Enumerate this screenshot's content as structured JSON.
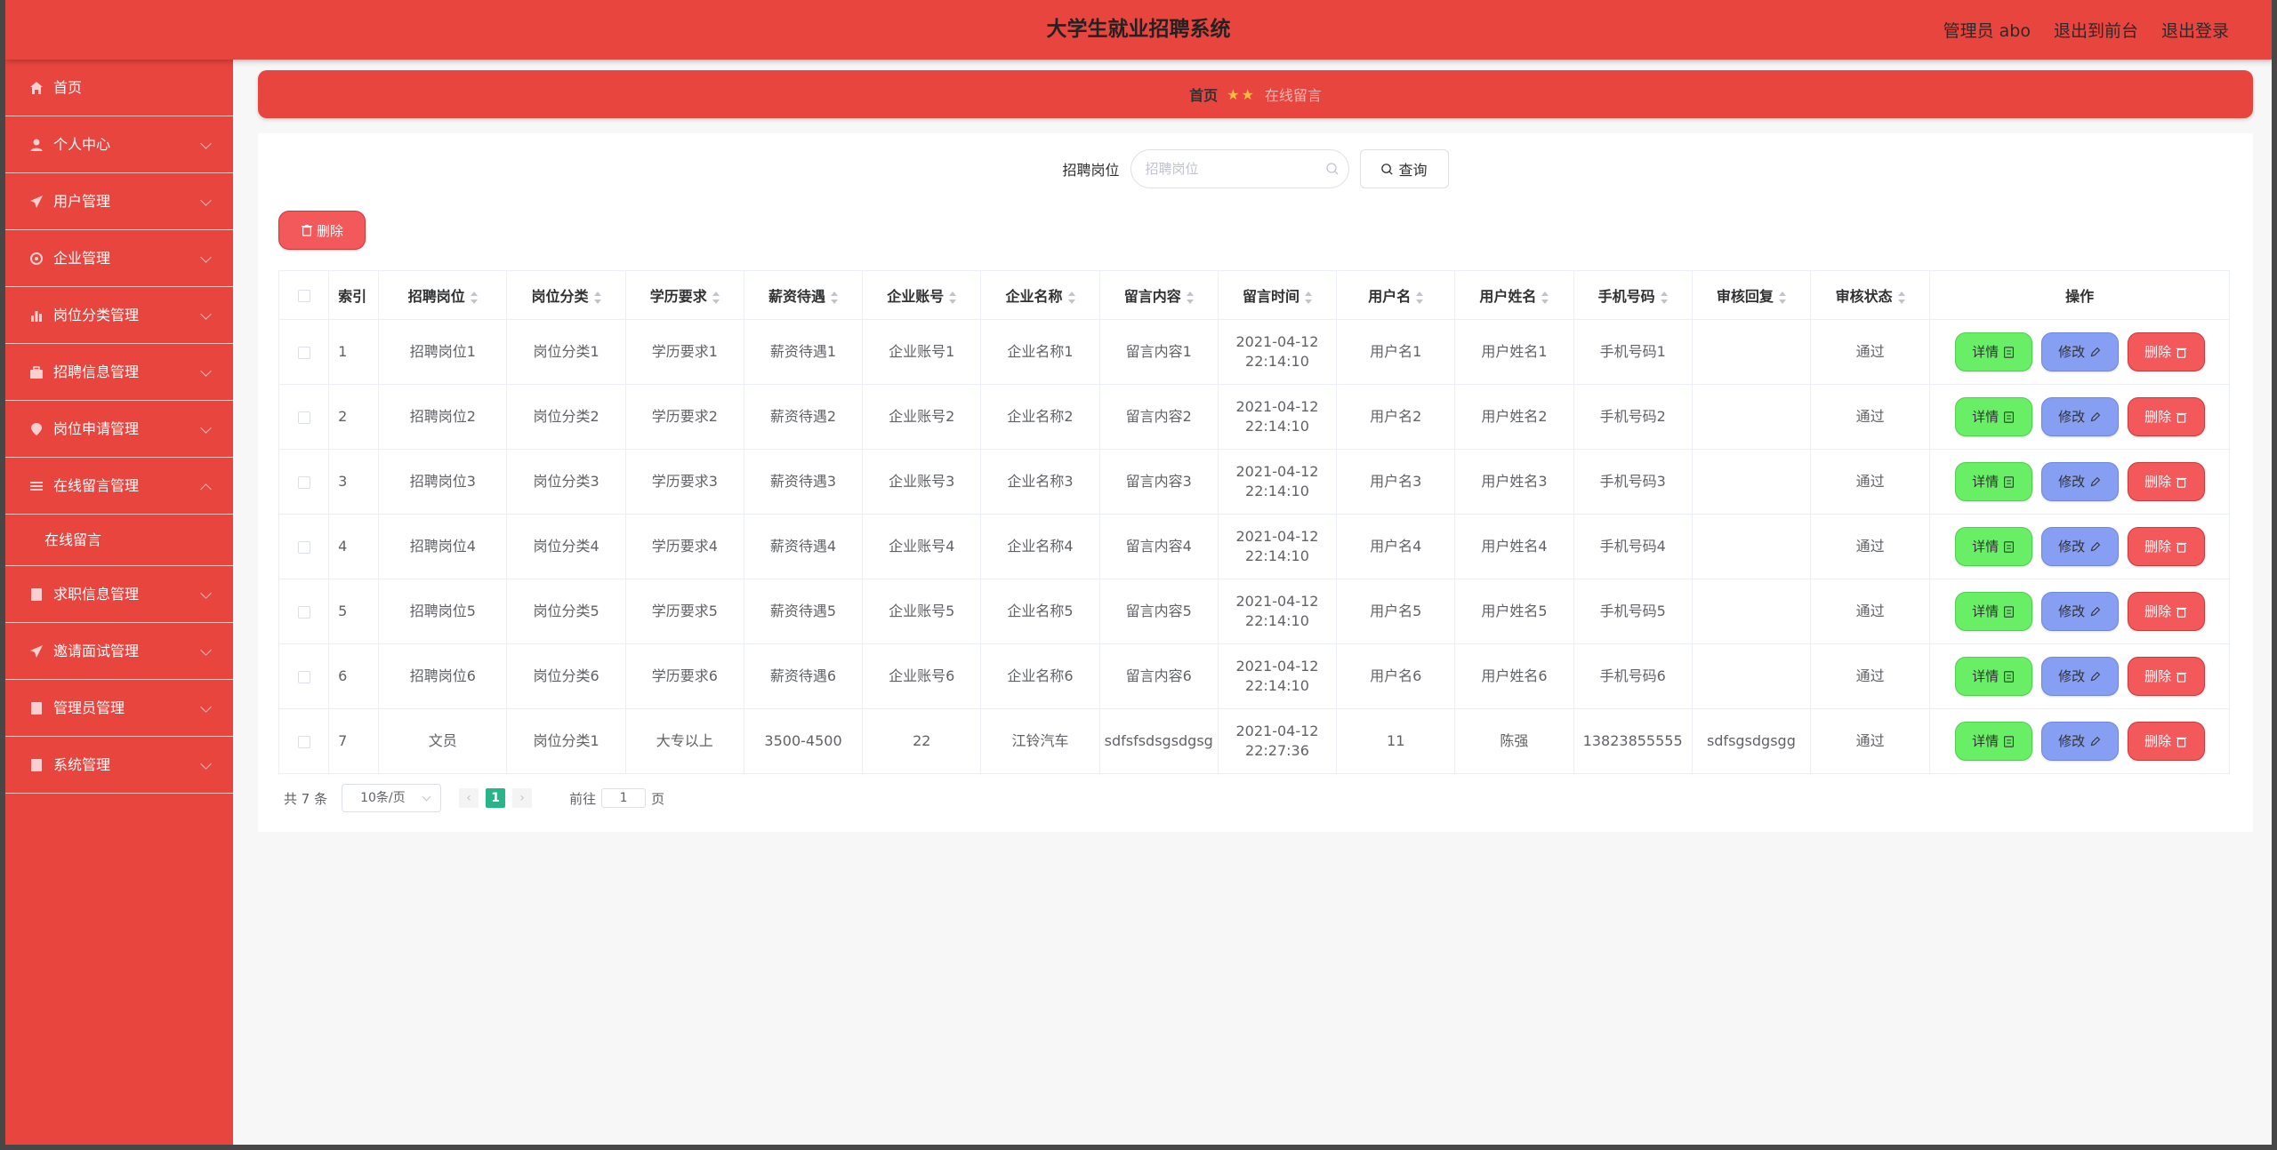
{
  "header": {
    "title": "大学生就业招聘系统",
    "admin_label": "管理员 abo",
    "front_link": "退出到前台",
    "logout_link": "退出登录"
  },
  "sidebar": {
    "items": [
      {
        "label": "首页",
        "icon": "home-icon"
      },
      {
        "label": "个人中心",
        "icon": "user-icon"
      },
      {
        "label": "用户管理",
        "icon": "send-icon"
      },
      {
        "label": "企业管理",
        "icon": "gear-icon"
      },
      {
        "label": "岗位分类管理",
        "icon": "bar-chart-icon"
      },
      {
        "label": "招聘信息管理",
        "icon": "briefcase-icon"
      },
      {
        "label": "岗位申请管理",
        "icon": "location-icon"
      },
      {
        "label": "在线留言管理",
        "icon": "menu-icon"
      },
      {
        "label": "求职信息管理",
        "icon": "document-icon"
      },
      {
        "label": "邀请面试管理",
        "icon": "send-icon"
      },
      {
        "label": "管理员管理",
        "icon": "document-icon"
      },
      {
        "label": "系统管理",
        "icon": "document-icon"
      }
    ],
    "sub_item": "在线留言"
  },
  "breadcrumb": {
    "home": "首页",
    "stars": "★★",
    "current": "在线留言"
  },
  "search": {
    "label": "招聘岗位",
    "placeholder": "招聘岗位",
    "button": "查询"
  },
  "toolbar": {
    "delete_label": "删除"
  },
  "table": {
    "headers": [
      "索引",
      "招聘岗位",
      "岗位分类",
      "学历要求",
      "薪资待遇",
      "企业账号",
      "企业名称",
      "留言内容",
      "留言时间",
      "用户名",
      "用户姓名",
      "手机号码",
      "审核回复",
      "审核状态",
      "操作"
    ],
    "rows": [
      [
        "1",
        "招聘岗位1",
        "岗位分类1",
        "学历要求1",
        "薪资待遇1",
        "企业账号1",
        "企业名称1",
        "留言内容1",
        "2021-04-12 22:14:10",
        "用户名1",
        "用户姓名1",
        "手机号码1",
        "",
        "通过"
      ],
      [
        "2",
        "招聘岗位2",
        "岗位分类2",
        "学历要求2",
        "薪资待遇2",
        "企业账号2",
        "企业名称2",
        "留言内容2",
        "2021-04-12 22:14:10",
        "用户名2",
        "用户姓名2",
        "手机号码2",
        "",
        "通过"
      ],
      [
        "3",
        "招聘岗位3",
        "岗位分类3",
        "学历要求3",
        "薪资待遇3",
        "企业账号3",
        "企业名称3",
        "留言内容3",
        "2021-04-12 22:14:10",
        "用户名3",
        "用户姓名3",
        "手机号码3",
        "",
        "通过"
      ],
      [
        "4",
        "招聘岗位4",
        "岗位分类4",
        "学历要求4",
        "薪资待遇4",
        "企业账号4",
        "企业名称4",
        "留言内容4",
        "2021-04-12 22:14:10",
        "用户名4",
        "用户姓名4",
        "手机号码4",
        "",
        "通过"
      ],
      [
        "5",
        "招聘岗位5",
        "岗位分类5",
        "学历要求5",
        "薪资待遇5",
        "企业账号5",
        "企业名称5",
        "留言内容5",
        "2021-04-12 22:14:10",
        "用户名5",
        "用户姓名5",
        "手机号码5",
        "",
        "通过"
      ],
      [
        "6",
        "招聘岗位6",
        "岗位分类6",
        "学历要求6",
        "薪资待遇6",
        "企业账号6",
        "企业名称6",
        "留言内容6",
        "2021-04-12 22:14:10",
        "用户名6",
        "用户姓名6",
        "手机号码6",
        "",
        "通过"
      ],
      [
        "7",
        "文员",
        "岗位分类1",
        "大专以上",
        "3500-4500",
        "22",
        "江铃汽车",
        "sdfsfsdsgsdgsg",
        "2021-04-12 22:27:36",
        "11",
        "陈强",
        "13823855555",
        "sdfsgsdgsgg",
        "通过"
      ]
    ],
    "actions": {
      "detail": "详情",
      "edit": "修改",
      "delete": "删除"
    }
  },
  "pagination": {
    "total": "共 7 条",
    "page_size": "10条/页",
    "current_page": "1",
    "jump_prefix": "前往",
    "jump_value": "1",
    "jump_suffix": "页",
    "prev": "‹",
    "next": "›"
  }
}
